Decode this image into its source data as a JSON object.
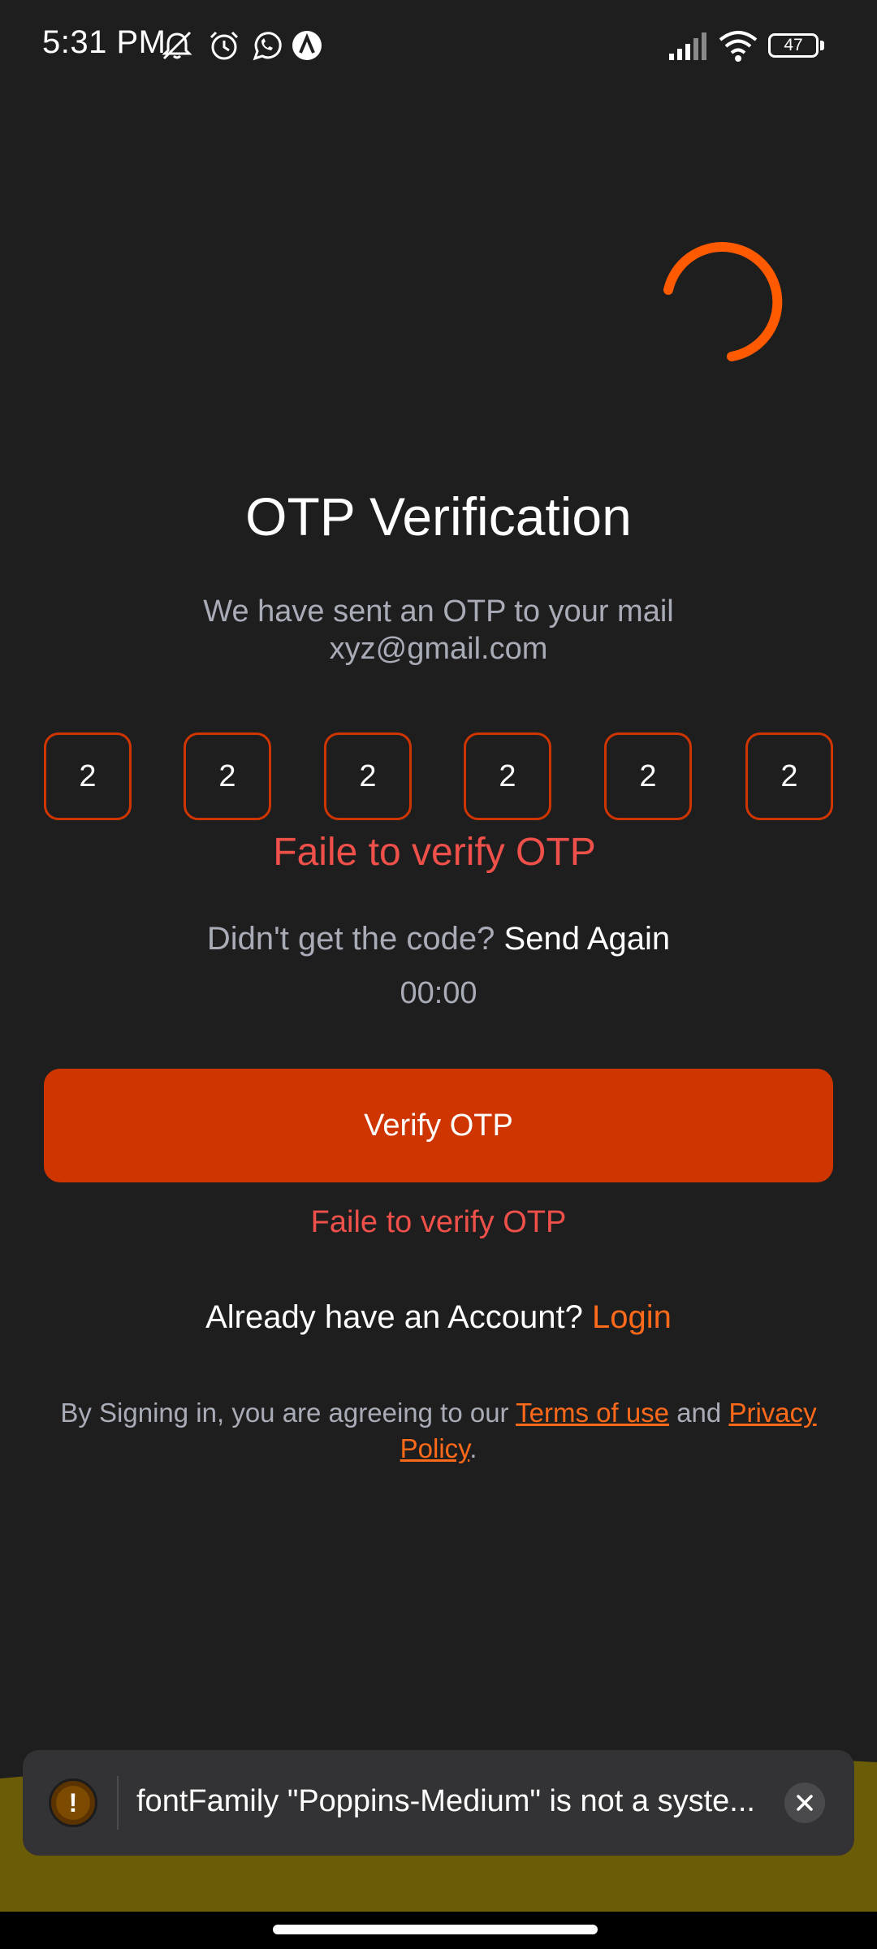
{
  "status_bar": {
    "time": "5:31 PM",
    "icons": [
      "mute-icon",
      "alarm-icon",
      "whatsapp-icon",
      "app-icon",
      "signal-icon",
      "wifi-icon"
    ],
    "battery": "47"
  },
  "otp": {
    "title": "OTP Verification",
    "subtitle_line1": "We have sent an OTP to your mail",
    "subtitle_line2": "xyz@gmail.com",
    "digits": [
      "2",
      "2",
      "2",
      "2",
      "2",
      "2"
    ],
    "error": "Faile to verify OTP"
  },
  "resend": {
    "prompt": "Didn't get the code?",
    "link": "Send Again",
    "timer": "00:00"
  },
  "verify": {
    "button_label": "Verify OTP",
    "error": "Faile to verify OTP"
  },
  "login": {
    "prompt": "Already have an Account?",
    "link": "Login"
  },
  "terms": {
    "prefix": "By Signing in, you are agreeing to our",
    "terms_link": "Terms of use",
    "and": "and",
    "privacy_link": "Privacy Policy",
    "suffix": "."
  },
  "toast": {
    "icon": "warning-icon",
    "message": "fontFamily \"Poppins-Medium\" is not a syste..."
  },
  "colors": {
    "background": "#1e1e1f",
    "accent": "#cf3500",
    "link": "#ff6a1a",
    "error": "#f0504a",
    "muted_text": "#a9acb7",
    "bottom_wave": "#6b5c07"
  }
}
